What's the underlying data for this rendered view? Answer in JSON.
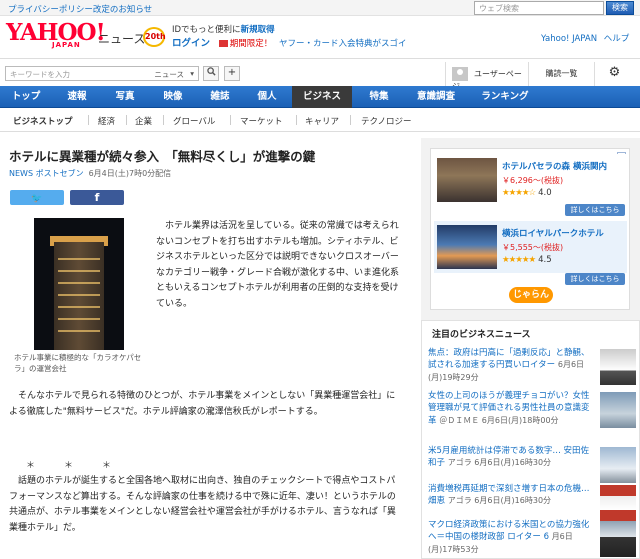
{
  "notice": "プライバシーポリシー改定のお知らせ",
  "top_search": {
    "placeholder": "ウェブ検索",
    "button": "検索"
  },
  "logo": {
    "main": "YAHOO!",
    "sub": "JAPAN",
    "service": "ニュース",
    "badge": "20th"
  },
  "login": {
    "line1_pre": "IDでもっと便利に",
    "line1_link": "新規取得",
    "login_label": "ログイン",
    "promo_label": "期間限定！",
    "promo_text": "ヤフー・カード入会特典がスゴイ"
  },
  "header_links": [
    "Yahoo! JAPAN",
    "ヘルプ"
  ],
  "keyword": {
    "placeholder": "キーワードを入力",
    "category": "ニュース"
  },
  "user_page": "ユーザーページ",
  "order_history": "購読一覧",
  "nav": [
    "トップ",
    "速報",
    "写真",
    "映像",
    "雑誌",
    "個人",
    "ビジネス",
    "特集",
    "意識調査",
    "ランキング"
  ],
  "nav_active": "ビジネス",
  "subnav": [
    "ビジネストップ",
    "経済",
    "企業",
    "グローバル",
    "マーケット",
    "キャリア",
    "テクノロジー"
  ],
  "article": {
    "title": "ホテルに異業種が続々参入　「無料尽くし」が進撃の鍵",
    "source_label": "NEWS ポストセブン",
    "date": "6月4日(土)7時0分配信",
    "twitter_label": "🐦",
    "facebook_label": "f",
    "caption": "ホテル事業に積極的な「カラオケパセラ」の運営会社",
    "lead": "ホテル業界は活況を呈している。従来の常識では考えられないコンセプトを打ち出すホテルも増加。シティホテル、ビジネスホテルといった区分では説明できないクロスオーバーなカテゴリー戦争・グレード合戦が激化する中、いま進化系ともいえるコンセプトホテルが利用者の圧倒的な支持を受けている。",
    "para2": "そんなホテルで見られる特徴のひとつが、ホテル事業をメインとしない「異業種運営会社」による徹底した\"無料サービス\"だ。ホテル評論家の瀧澤信秋氏がレポートする。",
    "separator": "＊　＊　＊",
    "para3": "話題のホテルが誕生すると全国各地へ取材に出向き、独自のチェックシートで得点やコストパフォーマンスなど算出する。そんな評論家の仕事を続ける中で殊に近年、凄い！というホテルの共通点が、ホテル事業をメインとしない経営会社や運営会社が手がけるホテル、言うなれば「異業種ホテル」だ。"
  },
  "ad": {
    "hotels": [
      {
        "name": "ホテルパセラの森 横浜関内",
        "price": "￥6,296〜(税抜)",
        "rating": "4.0",
        "stars": "★★★★☆",
        "button": "詳しくはこちら"
      },
      {
        "name": "横浜ロイヤルパークホテル",
        "price": "￥5,555〜(税抜)",
        "rating": "4.5",
        "stars": "★★★★★",
        "button": "詳しくはこちら"
      }
    ],
    "brand": "じゃらん",
    "info_icon": "i"
  },
  "news": {
    "heading": "注目のビジネスニュース",
    "items": [
      {
        "title": "焦点：政府は円高に「過剰反応」と静観、試される加速する円買いロイター",
        "meta": "6月6日(月)19時29分"
      },
      {
        "title": "女性の上司のほうが義理チョコがい？女性管理職が見て評価される男性社員の意識変革",
        "meta": "＠ＤＩＭＥ 6月6日(月)18時00分"
      },
      {
        "title": "米5月雇用統計は停滞である数字… 安田佐和子",
        "meta": "アゴラ 6月6日(月)16時30分"
      },
      {
        "title": "消費増税再延期で深刻さ増す日本の危機… 畑恵",
        "meta": "アゴラ 6月6日(月)16時30分"
      },
      {
        "title": "マクロ経済政策における米国との協力強化へ＝中国の楼財政部 ロイター 6",
        "meta": "月6日(月)17時53分"
      }
    ]
  }
}
